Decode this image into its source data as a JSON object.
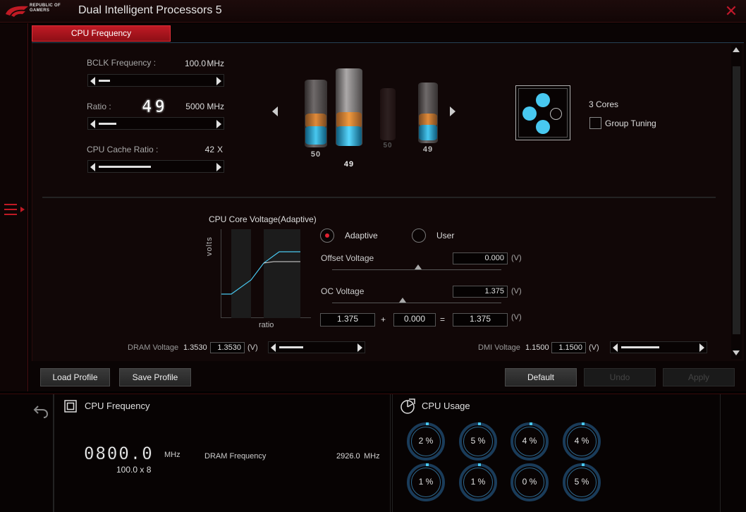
{
  "app": {
    "title": "Dual Intelligent Processors 5",
    "logo_text": [
      "REPUBLIC OF",
      "GAMERS"
    ]
  },
  "tab": {
    "label": "CPU Frequency"
  },
  "bclk": {
    "label": "BCLK Frequency :",
    "value": "100.0",
    "unit": "MHz",
    "level": 0.1
  },
  "ratio": {
    "label": "Ratio :",
    "big": "49",
    "value": "5000",
    "unit": "MHz",
    "level": 0.15
  },
  "cache": {
    "label": "CPU Cache Ratio :",
    "value": "42",
    "unit": "X",
    "level": 0.45
  },
  "cylinders": [
    "50",
    "49",
    "50",
    "49"
  ],
  "cores": {
    "label": "3 Cores",
    "group_tuning": "Group Tuning"
  },
  "voltage": {
    "title": "CPU Core Voltage(Adaptive)",
    "y_axis": "volts",
    "x_axis": "ratio",
    "adaptive": "Adaptive",
    "user": "User",
    "offset_label": "Offset Voltage",
    "offset_value": "0.000",
    "oc_label": "OC Voltage",
    "oc_value": "1.375",
    "unit": "(V)",
    "sum_a": "1.375",
    "plus": "+",
    "sum_b": "0.000",
    "equals": "=",
    "sum_c": "1.375"
  },
  "dram_voltage": {
    "label": "DRAM Voltage",
    "current": "1.3530",
    "input": "1.3530",
    "unit": "(V)"
  },
  "dmi_voltage": {
    "label": "DMI Voltage",
    "current": "1.1500",
    "input": "1.1500",
    "unit": "(V)"
  },
  "buttons": {
    "load": "Load Profile",
    "save": "Save Profile",
    "default": "Default",
    "undo": "Undo",
    "apply": "Apply"
  },
  "monitor": {
    "freq_title": "CPU Frequency",
    "freq_value": "0800.0",
    "freq_unit": "MHz",
    "freq_sub": "100.0 x 8",
    "dram_label": "DRAM Frequency",
    "dram_value": "2926.0",
    "dram_unit": "MHz",
    "usage_title": "CPU Usage",
    "usage": [
      "2 %",
      "5 %",
      "4 %",
      "4 %",
      "1 %",
      "1 %",
      "0 %",
      "5 %"
    ]
  },
  "colors": {
    "accent": "#c01a24",
    "cyan": "#48c8f0",
    "orange": "#e08a3a"
  }
}
